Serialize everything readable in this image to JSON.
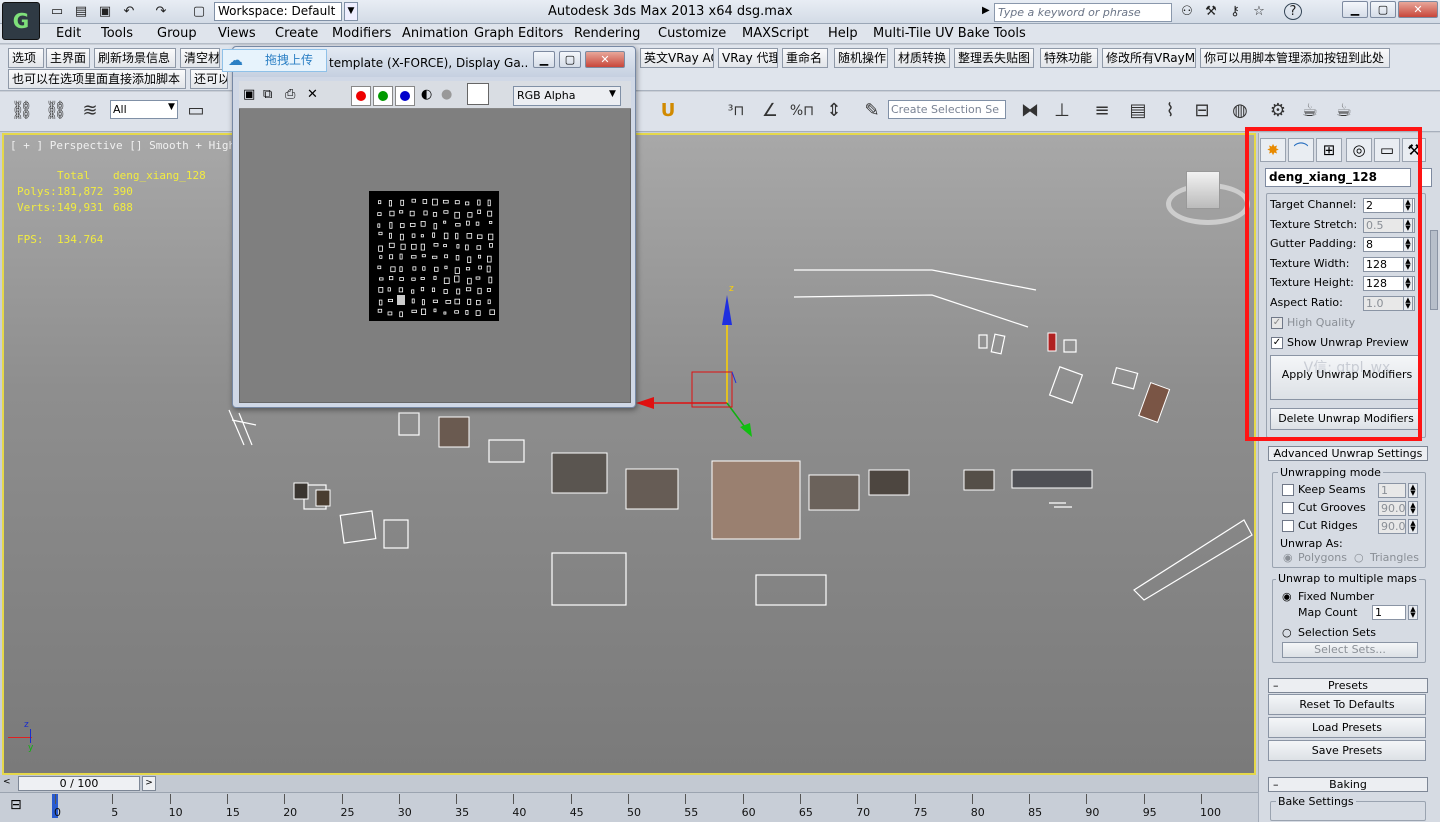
{
  "window": {
    "title": "Autodesk 3ds Max  2013 x64      dsg.max",
    "workspace": "Workspace: Default",
    "search_placeholder": "Type a keyword or phrase"
  },
  "menu": [
    "Edit",
    "Tools",
    "Group",
    "Views",
    "Create",
    "Modifiers",
    "Animation",
    "Graph Editors",
    "Rendering",
    "Customize",
    "MAXScript",
    "Help",
    "Multi-Tile UV Bake Tools"
  ],
  "custom_toolbar": {
    "row1": [
      "选项",
      "主界面",
      "刷新场景信息",
      "清空材",
      "英文VRay AO",
      "VRay 代理",
      "重命名",
      "随机操作",
      "材质转换",
      "整理丢失贴图",
      "特殊功能",
      "修改所有VRayMtl",
      "你可以用脚本管理添加按钮到此处"
    ],
    "row2": [
      "也可以在选项里面直接添加脚本",
      "还可以"
    ]
  },
  "main_toolbar": {
    "selection_filter": "All",
    "named_selection_placeholder": "Create Selection Se"
  },
  "viewport": {
    "label": "[ + ] Perspective [] Smooth + Highlight",
    "stats": {
      "header_total": "Total",
      "header_object": "deng_xiang_128",
      "polys_label": "Polys:",
      "polys_total": "181,872",
      "polys_object": "390",
      "verts_label": "Verts:",
      "verts_total": "149,931",
      "verts_object": "688",
      "fps_label": "FPS:",
      "fps_value": "134.764"
    }
  },
  "render_window": {
    "upload_label": "拖拽上传",
    "title": "template (X-FORCE), Display Ga...",
    "channel": "RGB Alpha"
  },
  "command_panel": {
    "object_name": "deng_xiang_128",
    "params": [
      {
        "label": "Target Channel:",
        "value": "2",
        "enabled": true
      },
      {
        "label": "Texture Stretch:",
        "value": "0.5",
        "enabled": false
      },
      {
        "label": "Gutter Padding:",
        "value": "8",
        "enabled": true
      },
      {
        "label": "Texture Width:",
        "value": "128",
        "enabled": true
      },
      {
        "label": "Texture Height:",
        "value": "128",
        "enabled": true
      },
      {
        "label": "Aspect Ratio:",
        "value": "1.0",
        "enabled": false
      }
    ],
    "high_quality": "High Quality",
    "show_unwrap_preview": "Show Unwrap Preview",
    "watermark": "V信: qtpl_wx",
    "apply_button": "Apply Unwrap Modifiers",
    "delete_button": "Delete Unwrap Modifiers",
    "advanced_title": "Advanced Unwrap Settings",
    "unwrapping_mode": "Unwrapping mode",
    "keep_seams": "Keep Seams",
    "keep_seams_value": "1",
    "cut_grooves": "Cut Grooves",
    "cut_grooves_value": "90.0",
    "cut_ridges": "Cut Ridges",
    "cut_ridges_value": "90.0",
    "unwrap_as": "Unwrap As:",
    "polygons": "Polygons",
    "triangles": "Triangles",
    "multiple_maps": "Unwrap to multiple maps",
    "fixed_number": "Fixed Number",
    "map_count_label": "Map Count",
    "map_count_value": "1",
    "selection_sets": "Selection Sets",
    "select_sets_button": "Select Sets...",
    "presets_title": "Presets",
    "reset_defaults": "Reset To Defaults",
    "load_presets": "Load Presets",
    "save_presets": "Save Presets",
    "baking_title": "Baking",
    "bake_settings": "Bake Settings"
  },
  "timeline": {
    "frame": "0 / 100",
    "ticks": [
      "0",
      "5",
      "10",
      "15",
      "20",
      "25",
      "30",
      "35",
      "40",
      "45",
      "50",
      "55",
      "60",
      "65",
      "70",
      "75",
      "80",
      "85",
      "90",
      "95",
      "100"
    ]
  },
  "colors": {
    "highlight": "#ff1414",
    "stats_text": "#f2ec40",
    "viewport_border": "#e5d84a"
  }
}
